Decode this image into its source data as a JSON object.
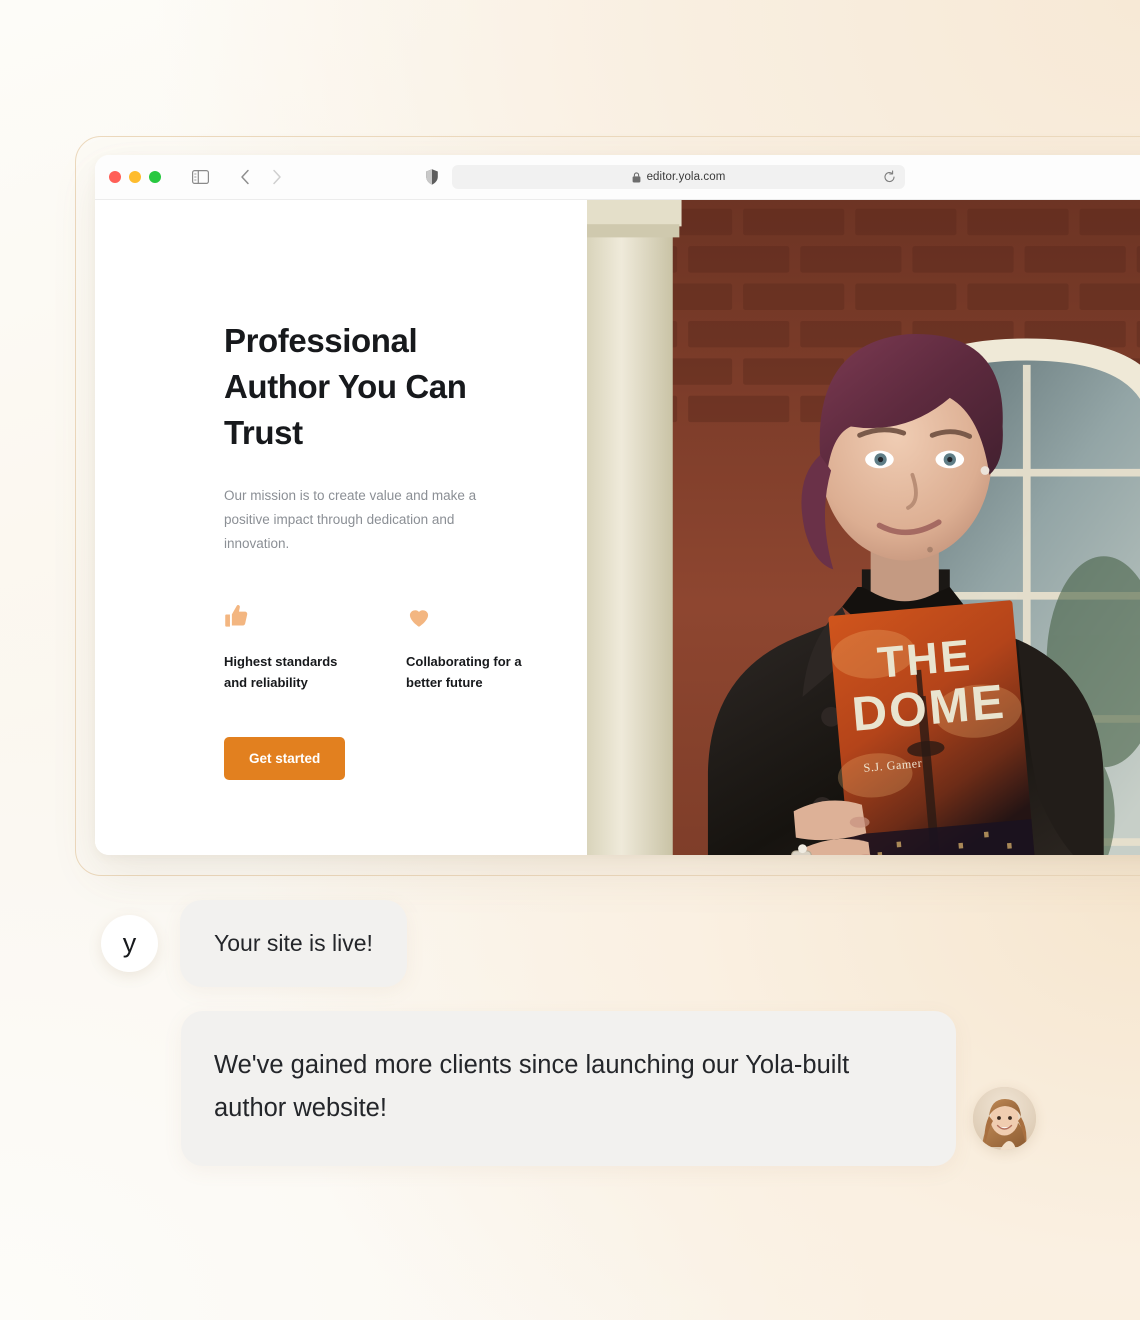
{
  "browser": {
    "traffic_lights": [
      {
        "name": "close",
        "color": "#ff5f57"
      },
      {
        "name": "minimize",
        "color": "#febc2e"
      },
      {
        "name": "maximize",
        "color": "#28c840"
      }
    ],
    "sidebar_toggle_icon": "sidebar-icon",
    "back_icon": "chevron-left-icon",
    "forward_icon": "chevron-right-icon",
    "shield_icon": "shield-icon",
    "lock_icon": "lock-icon",
    "url": "editor.yola.com",
    "reload_icon": "reload-icon"
  },
  "site": {
    "hero": {
      "title": "Professional Author You Can Trust",
      "subtitle": "Our mission is to create value and make a positive impact through dedication and innovation.",
      "cta_label": "Get started"
    },
    "features": [
      {
        "icon": "thumbs-up-icon",
        "label": "Highest standards and reliability"
      },
      {
        "icon": "heart-icon",
        "label": "Collaborating for a better future"
      }
    ],
    "photo": {
      "alt": "author-holding-book-photo",
      "book_title_line1": "THE",
      "book_title_line2": "DOME"
    },
    "accent_color": "#e2801f",
    "feature_icon_color": "#f3b681"
  },
  "chat": {
    "messages": [
      {
        "avatar": "yola-logo-avatar",
        "avatar_letter": "y",
        "text": "Your site is live!"
      },
      {
        "avatar": "customer-photo-avatar",
        "text": "We've gained more clients since launching our Yola-built author website!"
      }
    ]
  }
}
